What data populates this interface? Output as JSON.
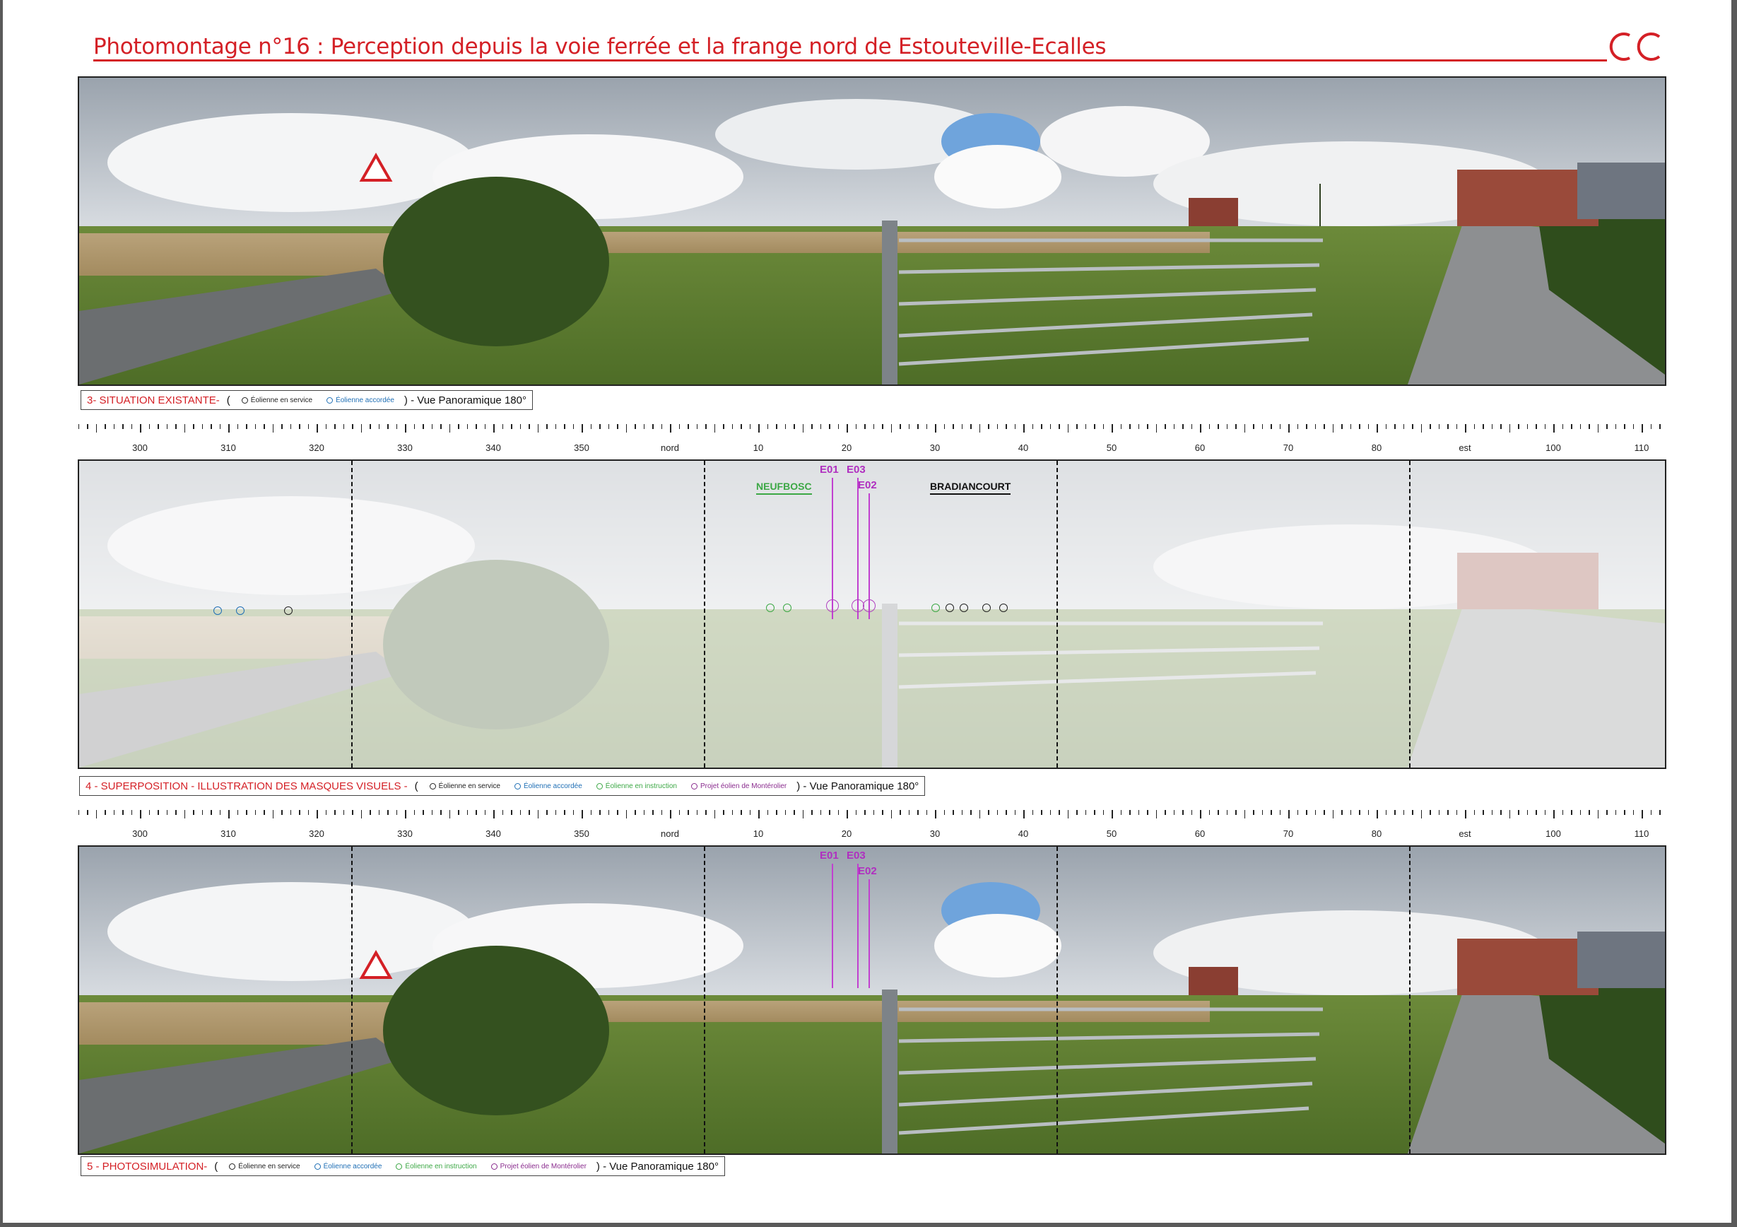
{
  "title": "Photomontage n°16 : Perception depuis la voie ferrée et la frange nord de Estouteville-Ecalles",
  "brand_color": "#d42026",
  "logo": "oc-logo",
  "legend_items": {
    "service": "Éolienne en service",
    "accordee": "Éolienne accordée",
    "instruction": "Éolienne en instruction",
    "projet": "Projet éolien de Montérolier"
  },
  "colors": {
    "service": "#222222",
    "accordee": "#1f6fb5",
    "instruction": "#3ca845",
    "projet": "#8a2c8e"
  },
  "panels": [
    {
      "caption": "3- SITUATION EXISTANTE-",
      "suffix": ") - Vue Panoramique 180°"
    },
    {
      "caption": "4 - SUPERPOSITION - ILLUSTRATION DES MASQUES VISUELS -",
      "suffix": ") - Vue Panoramique 180°"
    },
    {
      "caption": "5 - PHOTOSIMULATION-",
      "suffix": ") - Vue Panoramique 180°"
    }
  ],
  "scale_labels": [
    "300",
    "310",
    "320",
    "330",
    "340",
    "350",
    "nord",
    "10",
    "20",
    "30",
    "40",
    "50",
    "60",
    "70",
    "80",
    "est",
    "100",
    "110"
  ],
  "turbines": [
    "E01",
    "E03",
    "E02"
  ],
  "places": {
    "west": "NEUFBOSC",
    "east": "BRADIANCOURT"
  }
}
